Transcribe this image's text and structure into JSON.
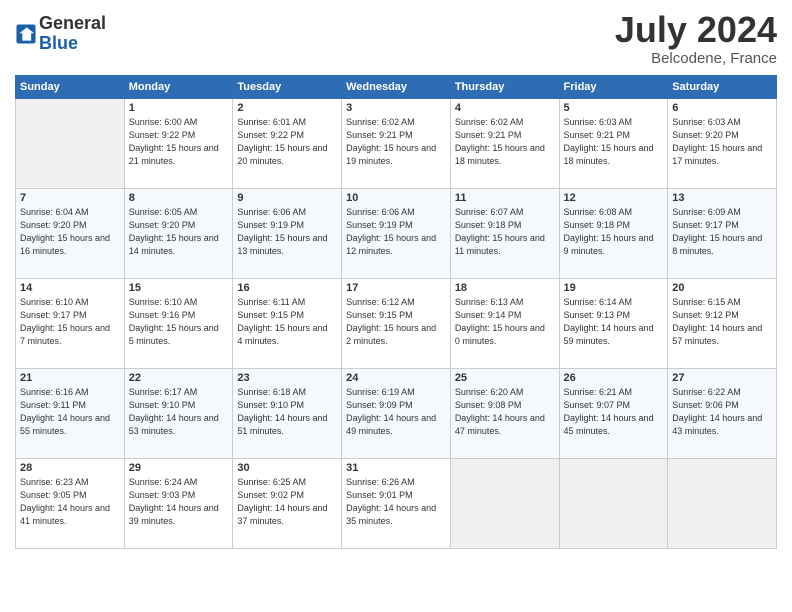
{
  "header": {
    "logo_line1": "General",
    "logo_line2": "Blue",
    "month": "July 2024",
    "location": "Belcodene, France"
  },
  "weekdays": [
    "Sunday",
    "Monday",
    "Tuesday",
    "Wednesday",
    "Thursday",
    "Friday",
    "Saturday"
  ],
  "weeks": [
    [
      {
        "day": "",
        "empty": true
      },
      {
        "day": "1",
        "sunrise": "6:00 AM",
        "sunset": "9:22 PM",
        "daylight": "15 hours and 21 minutes."
      },
      {
        "day": "2",
        "sunrise": "6:01 AM",
        "sunset": "9:22 PM",
        "daylight": "15 hours and 20 minutes."
      },
      {
        "day": "3",
        "sunrise": "6:02 AM",
        "sunset": "9:21 PM",
        "daylight": "15 hours and 19 minutes."
      },
      {
        "day": "4",
        "sunrise": "6:02 AM",
        "sunset": "9:21 PM",
        "daylight": "15 hours and 18 minutes."
      },
      {
        "day": "5",
        "sunrise": "6:03 AM",
        "sunset": "9:21 PM",
        "daylight": "15 hours and 18 minutes."
      },
      {
        "day": "6",
        "sunrise": "6:03 AM",
        "sunset": "9:20 PM",
        "daylight": "15 hours and 17 minutes."
      }
    ],
    [
      {
        "day": "7",
        "sunrise": "6:04 AM",
        "sunset": "9:20 PM",
        "daylight": "15 hours and 16 minutes."
      },
      {
        "day": "8",
        "sunrise": "6:05 AM",
        "sunset": "9:20 PM",
        "daylight": "15 hours and 14 minutes."
      },
      {
        "day": "9",
        "sunrise": "6:06 AM",
        "sunset": "9:19 PM",
        "daylight": "15 hours and 13 minutes."
      },
      {
        "day": "10",
        "sunrise": "6:06 AM",
        "sunset": "9:19 PM",
        "daylight": "15 hours and 12 minutes."
      },
      {
        "day": "11",
        "sunrise": "6:07 AM",
        "sunset": "9:18 PM",
        "daylight": "15 hours and 11 minutes."
      },
      {
        "day": "12",
        "sunrise": "6:08 AM",
        "sunset": "9:18 PM",
        "daylight": "15 hours and 9 minutes."
      },
      {
        "day": "13",
        "sunrise": "6:09 AM",
        "sunset": "9:17 PM",
        "daylight": "15 hours and 8 minutes."
      }
    ],
    [
      {
        "day": "14",
        "sunrise": "6:10 AM",
        "sunset": "9:17 PM",
        "daylight": "15 hours and 7 minutes."
      },
      {
        "day": "15",
        "sunrise": "6:10 AM",
        "sunset": "9:16 PM",
        "daylight": "15 hours and 5 minutes."
      },
      {
        "day": "16",
        "sunrise": "6:11 AM",
        "sunset": "9:15 PM",
        "daylight": "15 hours and 4 minutes."
      },
      {
        "day": "17",
        "sunrise": "6:12 AM",
        "sunset": "9:15 PM",
        "daylight": "15 hours and 2 minutes."
      },
      {
        "day": "18",
        "sunrise": "6:13 AM",
        "sunset": "9:14 PM",
        "daylight": "15 hours and 0 minutes."
      },
      {
        "day": "19",
        "sunrise": "6:14 AM",
        "sunset": "9:13 PM",
        "daylight": "14 hours and 59 minutes."
      },
      {
        "day": "20",
        "sunrise": "6:15 AM",
        "sunset": "9:12 PM",
        "daylight": "14 hours and 57 minutes."
      }
    ],
    [
      {
        "day": "21",
        "sunrise": "6:16 AM",
        "sunset": "9:11 PM",
        "daylight": "14 hours and 55 minutes."
      },
      {
        "day": "22",
        "sunrise": "6:17 AM",
        "sunset": "9:10 PM",
        "daylight": "14 hours and 53 minutes."
      },
      {
        "day": "23",
        "sunrise": "6:18 AM",
        "sunset": "9:10 PM",
        "daylight": "14 hours and 51 minutes."
      },
      {
        "day": "24",
        "sunrise": "6:19 AM",
        "sunset": "9:09 PM",
        "daylight": "14 hours and 49 minutes."
      },
      {
        "day": "25",
        "sunrise": "6:20 AM",
        "sunset": "9:08 PM",
        "daylight": "14 hours and 47 minutes."
      },
      {
        "day": "26",
        "sunrise": "6:21 AM",
        "sunset": "9:07 PM",
        "daylight": "14 hours and 45 minutes."
      },
      {
        "day": "27",
        "sunrise": "6:22 AM",
        "sunset": "9:06 PM",
        "daylight": "14 hours and 43 minutes."
      }
    ],
    [
      {
        "day": "28",
        "sunrise": "6:23 AM",
        "sunset": "9:05 PM",
        "daylight": "14 hours and 41 minutes."
      },
      {
        "day": "29",
        "sunrise": "6:24 AM",
        "sunset": "9:03 PM",
        "daylight": "14 hours and 39 minutes."
      },
      {
        "day": "30",
        "sunrise": "6:25 AM",
        "sunset": "9:02 PM",
        "daylight": "14 hours and 37 minutes."
      },
      {
        "day": "31",
        "sunrise": "6:26 AM",
        "sunset": "9:01 PM",
        "daylight": "14 hours and 35 minutes."
      },
      {
        "day": "",
        "empty": true
      },
      {
        "day": "",
        "empty": true
      },
      {
        "day": "",
        "empty": true
      }
    ]
  ],
  "labels": {
    "sunrise": "Sunrise:",
    "sunset": "Sunset:",
    "daylight": "Daylight:"
  }
}
